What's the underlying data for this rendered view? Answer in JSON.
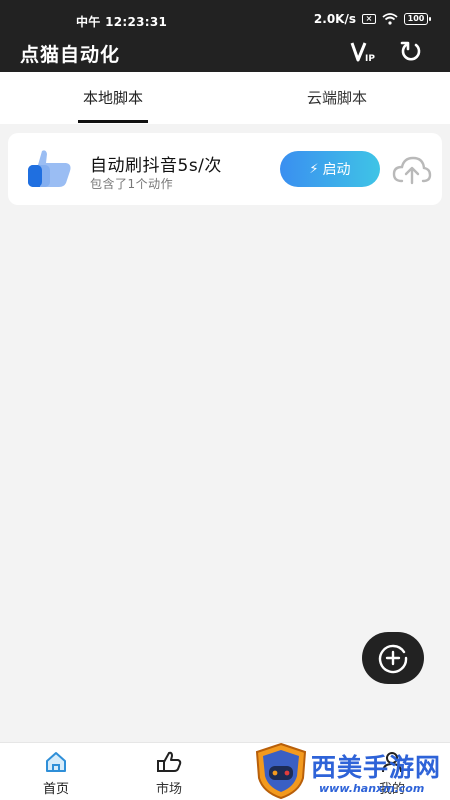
{
  "status_bar": {
    "time": "中午 12:23:31",
    "network_speed": "2.0K/s",
    "sim_icon_label": "×",
    "battery": "100"
  },
  "app_bar": {
    "title": "点猫自动化",
    "vip_icon": "vip-icon",
    "refresh_icon": "refresh-icon"
  },
  "tabs": [
    {
      "label": "本地脚本",
      "active": true
    },
    {
      "label": "云端脚本",
      "active": false
    }
  ],
  "scripts": [
    {
      "title": "自动刷抖音5s/次",
      "subtitle": "包含了1个动作",
      "start_label": "启动",
      "icon": "thumbs-up-icon",
      "upload_icon": "cloud-upload-icon"
    }
  ],
  "fab": {
    "icon": "add-circle-icon"
  },
  "bottom_nav": [
    {
      "label": "首页",
      "icon": "home-icon",
      "active": true
    },
    {
      "label": "市场",
      "icon": "market-hand-icon",
      "active": false
    },
    {
      "label": "我的",
      "icon": "user-icon",
      "active": false
    }
  ],
  "watermark": {
    "text": "西美手游网",
    "url": "www.hanxm.com"
  },
  "colors": {
    "topbar": "#222222",
    "accent_start": "#3a8ff0",
    "accent_end": "#3fc4e6",
    "background": "#f3f3f3",
    "watermark": "#2e63d8"
  }
}
